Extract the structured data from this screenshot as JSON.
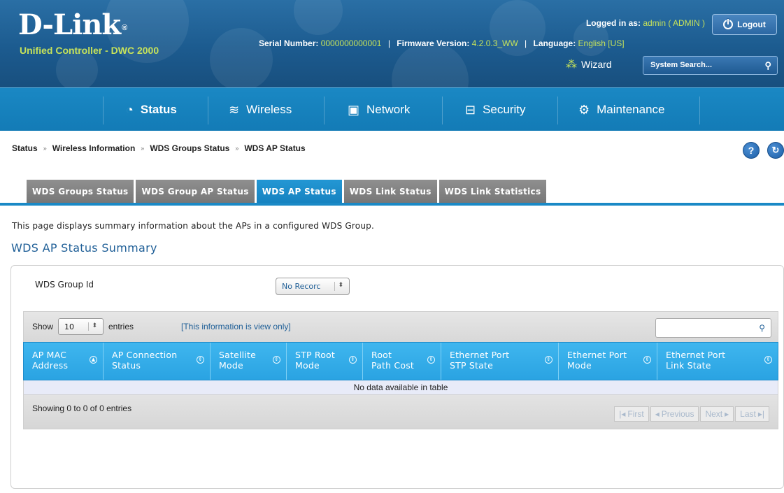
{
  "brand": {
    "logo": "D-Link",
    "registered_mark": "®",
    "subtitle": "Unified Controller - DWC 2000"
  },
  "header": {
    "logged_in_label": "Logged in as:",
    "logged_in_user": "admin ( ADMIN )",
    "logout_label": "Logout",
    "serial_label": "Serial Number:",
    "serial_value": "0000000000001",
    "firmware_label": "Firmware Version:",
    "firmware_value": "4.2.0.3_WW",
    "language_label": "Language:",
    "language_value": "English [US]",
    "separator": "|",
    "wizard_label": "Wizard",
    "search_placeholder": "System Search..."
  },
  "nav": {
    "items": [
      {
        "label": "Status",
        "icon": "dashboard-icon",
        "active": true
      },
      {
        "label": "Wireless",
        "icon": "wifi-icon",
        "active": false
      },
      {
        "label": "Network",
        "icon": "monitor-icon",
        "active": false
      },
      {
        "label": "Security",
        "icon": "lock-icon",
        "active": false
      },
      {
        "label": "Maintenance",
        "icon": "gears-icon",
        "active": false
      }
    ]
  },
  "breadcrumb": {
    "items": [
      "Status",
      "Wireless Information",
      "WDS Groups Status",
      "WDS AP Status"
    ],
    "separator": "»"
  },
  "tabs": [
    {
      "label": "WDS Groups Status",
      "active": false
    },
    {
      "label": "WDS Group AP Status",
      "active": false
    },
    {
      "label": "WDS AP Status",
      "active": true
    },
    {
      "label": "WDS Link Status",
      "active": false
    },
    {
      "label": "WDS Link Statistics",
      "active": false
    }
  ],
  "page": {
    "intro": "This page displays summary information about the APs in a configured WDS Group.",
    "section_title": "WDS AP Status Summary",
    "group_id_label": "WDS Group Id",
    "group_id_value": "No Recorc"
  },
  "table": {
    "show_label": "Show",
    "entries_value": "10",
    "entries_label": "entries",
    "view_only_note": "[This information is view only]",
    "columns": [
      {
        "label_line1": "AP MAC",
        "label_line2": "Address"
      },
      {
        "label_line1": "AP Connection",
        "label_line2": "Status"
      },
      {
        "label_line1": "Satellite",
        "label_line2": "Mode"
      },
      {
        "label_line1": "STP Root",
        "label_line2": "Mode"
      },
      {
        "label_line1": "Root",
        "label_line2": "Path Cost"
      },
      {
        "label_line1": "Ethernet Port",
        "label_line2": "STP State"
      },
      {
        "label_line1": "Ethernet Port",
        "label_line2": "Mode"
      },
      {
        "label_line1": "Ethernet Port",
        "label_line2": "Link State"
      }
    ],
    "empty_message": "No data available in table",
    "showing_text": "Showing 0 to 0 of 0 entries",
    "pager": {
      "first": "First",
      "previous": "Previous",
      "next": "Next",
      "last": "Last"
    }
  },
  "colors": {
    "header_blue": "#1c5b8f",
    "nav_blue": "#137bb6",
    "accent_green": "#c6e25a",
    "table_header": "#2aa3e2"
  }
}
